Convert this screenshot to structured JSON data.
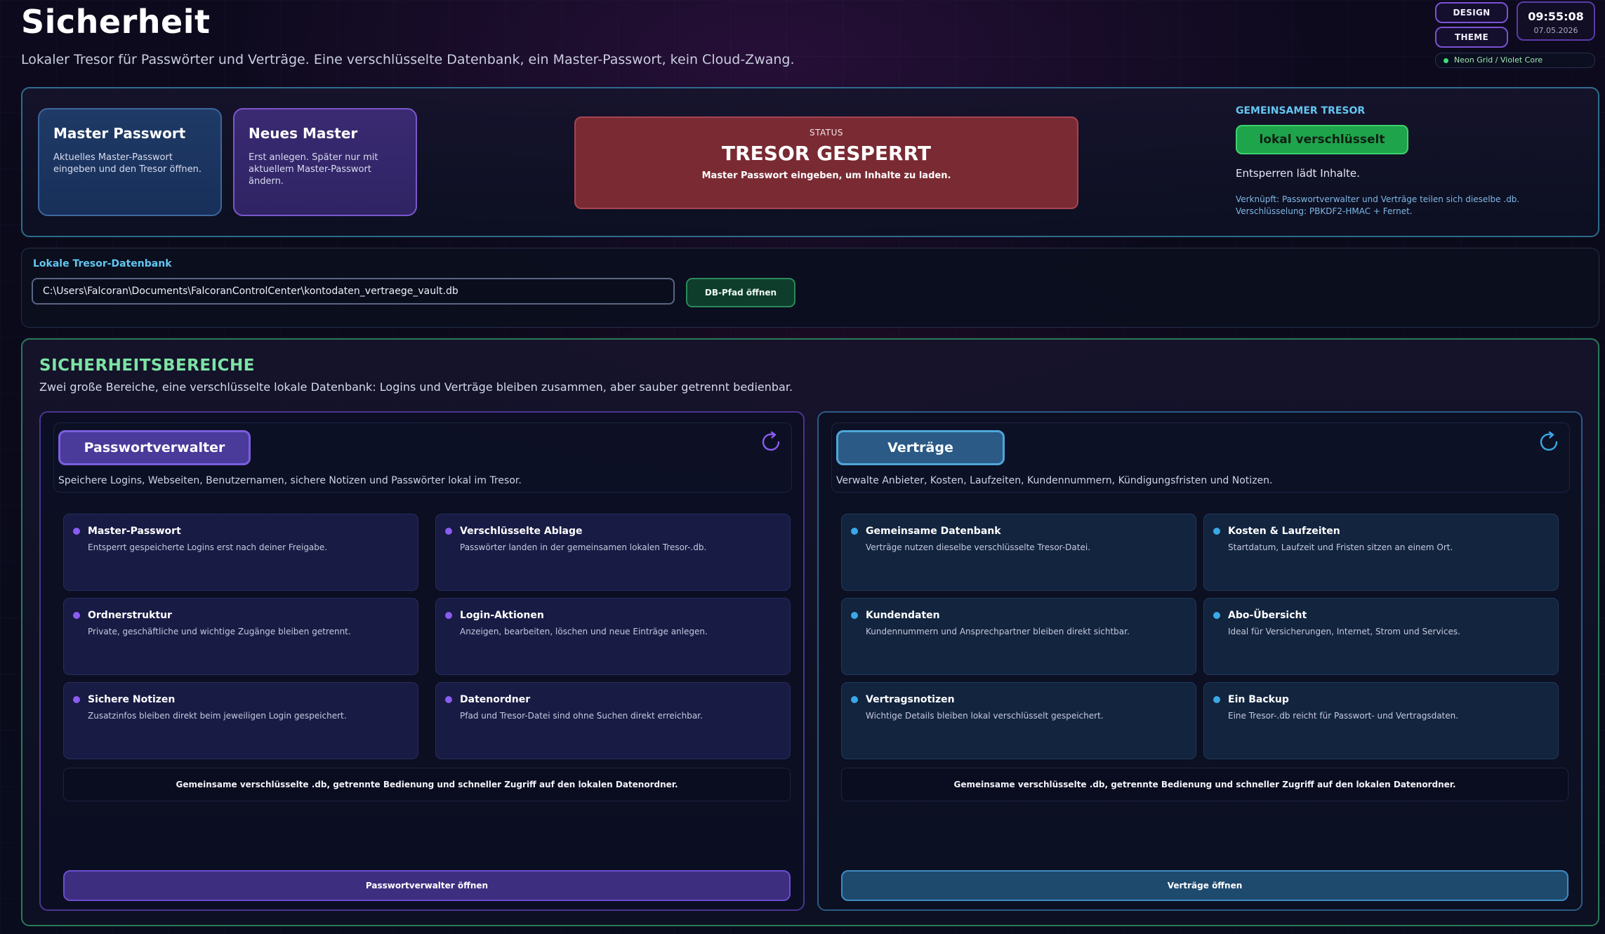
{
  "header": {
    "title": "Sicherheit",
    "subtitle": "Lokaler Tresor für Passwörter und Verträge. Eine verschlüsselte Datenbank, ein Master-Passwort, kein Cloud-Zwang."
  },
  "top_controls": {
    "design_label": "DESIGN",
    "theme_label": "THEME",
    "clock_time": "09:55:08",
    "clock_date": "07.05.2026",
    "theme_name": "Neon Grid / Violet Core"
  },
  "master": {
    "card1_title": "Master Passwort",
    "card1_text": "Aktuelles Master-Passwort eingeben und den Tresor öffnen.",
    "card2_title": "Neues Master",
    "card2_text": "Erst anlegen. Später nur mit aktuellem Master-Passwort ändern."
  },
  "status": {
    "label": "STATUS",
    "title": "TRESOR GESPERRT",
    "hint": "Master Passwort eingeben, um Inhalte zu laden."
  },
  "shared": {
    "label": "GEMEINSAMER TRESOR",
    "badge": "lokal verschlüsselt",
    "info": "Entsperren lädt Inhalte.",
    "note": "Verknüpft: Passwortverwalter und Verträge teilen sich dieselbe .db. Verschlüsselung: PBKDF2-HMAC + Fernet."
  },
  "database": {
    "label": "Lokale Tresor-Datenbank",
    "path": "C:\\Users\\Falcoran\\Documents\\FalcoranControlCenter\\kontodaten_vertraege_vault.db",
    "button": "DB-Pfad öffnen"
  },
  "security": {
    "title": "SICHERHEITSBEREICHE",
    "subtitle": "Zwei große Bereiche, eine verschlüsselte lokale Datenbank: Logins und Verträge bleiben zusammen, aber sauber getrennt bedienbar."
  },
  "password_area": {
    "chip": "Passwortverwalter",
    "description": "Speichere Logins, Webseiten, Benutzernamen, sichere Notizen und Passwörter lokal im Tresor.",
    "features": [
      {
        "title": "Master-Passwort",
        "text": "Entsperrt gespeicherte Logins erst nach deiner Freigabe."
      },
      {
        "title": "Verschlüsselte Ablage",
        "text": "Passwörter landen in der gemeinsamen lokalen Tresor-.db."
      },
      {
        "title": "Ordnerstruktur",
        "text": "Private, geschäftliche und wichtige Zugänge bleiben getrennt."
      },
      {
        "title": "Login-Aktionen",
        "text": "Anzeigen, bearbeiten, löschen und neue Einträge anlegen."
      },
      {
        "title": "Sichere Notizen",
        "text": "Zusatzinfos bleiben direkt beim jeweiligen Login gespeichert."
      },
      {
        "title": "Datenordner",
        "text": "Pfad und Tresor-Datei sind ohne Suchen direkt erreichbar."
      }
    ],
    "footer": "Gemeinsame verschlüsselte .db, getrennte Bedienung und schneller Zugriff auf den lokalen Datenordner.",
    "open_button": "Passwortverwalter öffnen"
  },
  "contracts_area": {
    "chip": "Verträge",
    "description": "Verwalte Anbieter, Kosten, Laufzeiten, Kundennummern, Kündigungsfristen und Notizen.",
    "features": [
      {
        "title": "Gemeinsame Datenbank",
        "text": "Verträge nutzen dieselbe verschlüsselte Tresor-Datei."
      },
      {
        "title": "Kosten & Laufzeiten",
        "text": "Startdatum, Laufzeit und Fristen sitzen an einem Ort."
      },
      {
        "title": "Kundendaten",
        "text": "Kundennummern und Ansprechpartner bleiben direkt sichtbar."
      },
      {
        "title": "Abo-Übersicht",
        "text": "Ideal für Versicherungen, Internet, Strom und Services."
      },
      {
        "title": "Vertragsnotizen",
        "text": "Wichtige Details bleiben lokal verschlüsselt gespeichert."
      },
      {
        "title": "Ein Backup",
        "text": "Eine Tresor-.db reicht für Passwort- und Vertragsdaten."
      }
    ],
    "footer": "Gemeinsame verschlüsselte .db, getrennte Bedienung und schneller Zugriff auf den lokalen Datenordner.",
    "open_button": "Verträge öffnen"
  },
  "colors": {
    "violet_accent": "#8a5cf0",
    "cyan_accent": "#3aa8e8",
    "locked_red": "#7a2a33",
    "success_green": "#1ea44a"
  },
  "icons": {
    "refresh": "refresh-icon",
    "status_dot": "status-dot-icon"
  }
}
